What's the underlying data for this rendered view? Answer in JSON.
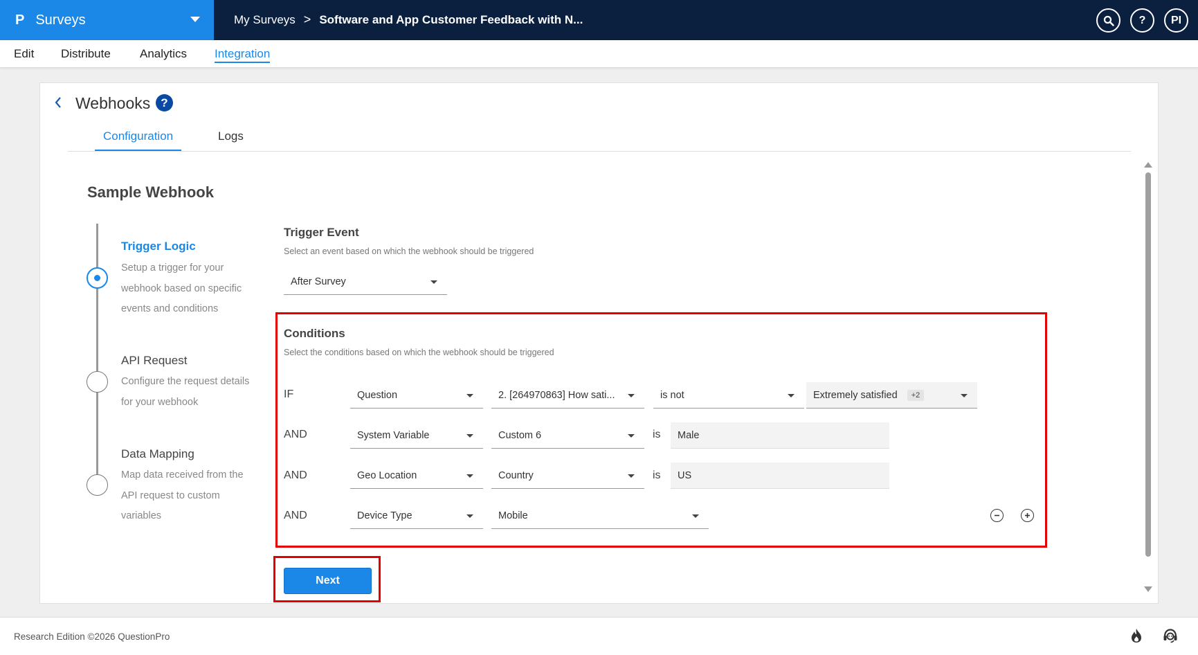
{
  "topbar": {
    "brand_logo": "P",
    "brand_name": "Surveys",
    "breadcrumb_root": "My Surveys",
    "breadcrumb_sep": ">",
    "breadcrumb_current": "Software and App Customer Feedback with N...",
    "search_icon": "search-icon",
    "help_label": "?",
    "avatar_initials": "PI"
  },
  "subnav": {
    "items": [
      "Edit",
      "Distribute",
      "Analytics",
      "Integration"
    ],
    "active": "Integration"
  },
  "page": {
    "back_icon": "chevron-left-icon",
    "title": "Webhooks",
    "help_label": "?",
    "tabs": [
      "Configuration",
      "Logs"
    ],
    "active_tab": "Configuration",
    "webhook_name": "Sample Webhook"
  },
  "steps": [
    {
      "title": "Trigger Logic",
      "desc": "Setup a trigger for your webhook based on specific events and conditions",
      "active": true
    },
    {
      "title": "API Request",
      "desc": "Configure the request details for your webhook",
      "active": false
    },
    {
      "title": "Data Mapping",
      "desc": "Map data received from the API request to custom variables",
      "active": false
    }
  ],
  "trigger": {
    "heading": "Trigger Event",
    "hint": "Select an event based on which the webhook should be triggered",
    "value": "After Survey"
  },
  "conditions": {
    "heading": "Conditions",
    "hint": "Select the conditions based on which the webhook should be triggered",
    "rows": [
      {
        "keyword": "IF",
        "source": "Question",
        "field": "2. [264970863] How sati...",
        "operator": "is not",
        "value": "Extremely satisfied",
        "extra": "+2"
      },
      {
        "keyword": "AND",
        "source": "System Variable",
        "field": "Custom 6",
        "operator": "is",
        "value": "Male"
      },
      {
        "keyword": "AND",
        "source": "Geo Location",
        "field": "Country",
        "operator": "is",
        "value": "US"
      },
      {
        "keyword": "AND",
        "source": "Device Type",
        "field": "Mobile"
      }
    ],
    "remove_icon": "minus-circle-icon",
    "add_icon": "plus-circle-icon"
  },
  "next_label": "Next",
  "footer": {
    "copyright": "Research Edition ©2026 QuestionPro",
    "icons": [
      "flame-icon",
      "support-agent-icon"
    ]
  },
  "colors": {
    "topbar": "#0b1f3f",
    "brand": "#1b87e6",
    "accent": "#1b87e6",
    "highlight_box": "#e30000"
  }
}
